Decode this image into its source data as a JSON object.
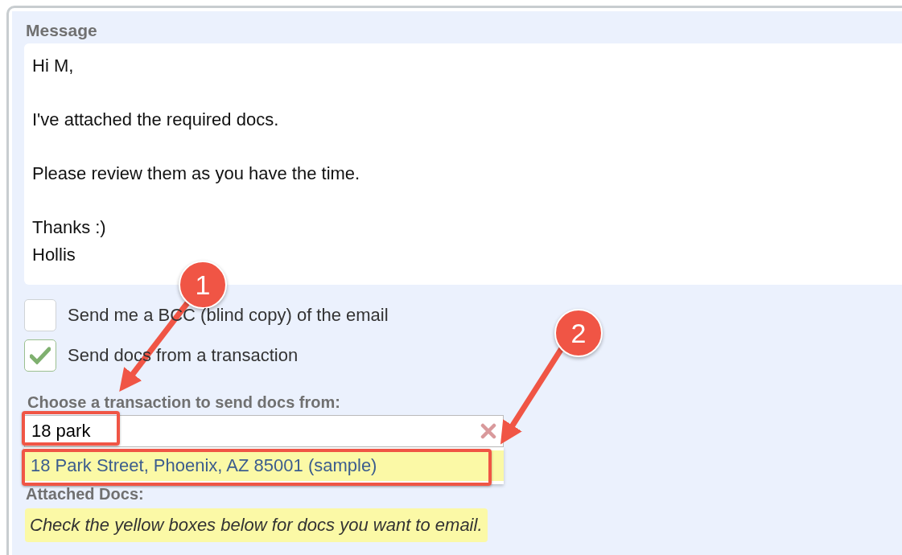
{
  "message": {
    "label": "Message",
    "value": "Hi M,\n\nI've attached the required docs.\n\nPlease review them as you have the time.\n\nThanks :)\nHollis"
  },
  "options": [
    {
      "label": "Send me a BCC (blind copy) of the email",
      "checked": false
    },
    {
      "label": "Send docs from a transaction",
      "checked": true
    }
  ],
  "transaction": {
    "label": "Choose a transaction to send docs from:",
    "value": "18 park",
    "suggestions": [
      {
        "text": "18 Park Street, Phoenix, AZ 85001 (sample)",
        "highlighted": true
      }
    ]
  },
  "attached": {
    "label": "Attached Docs:",
    "note": "Check the yellow boxes below for docs you want to email."
  },
  "annotations": [
    {
      "number": "1"
    },
    {
      "number": "2"
    }
  ]
}
